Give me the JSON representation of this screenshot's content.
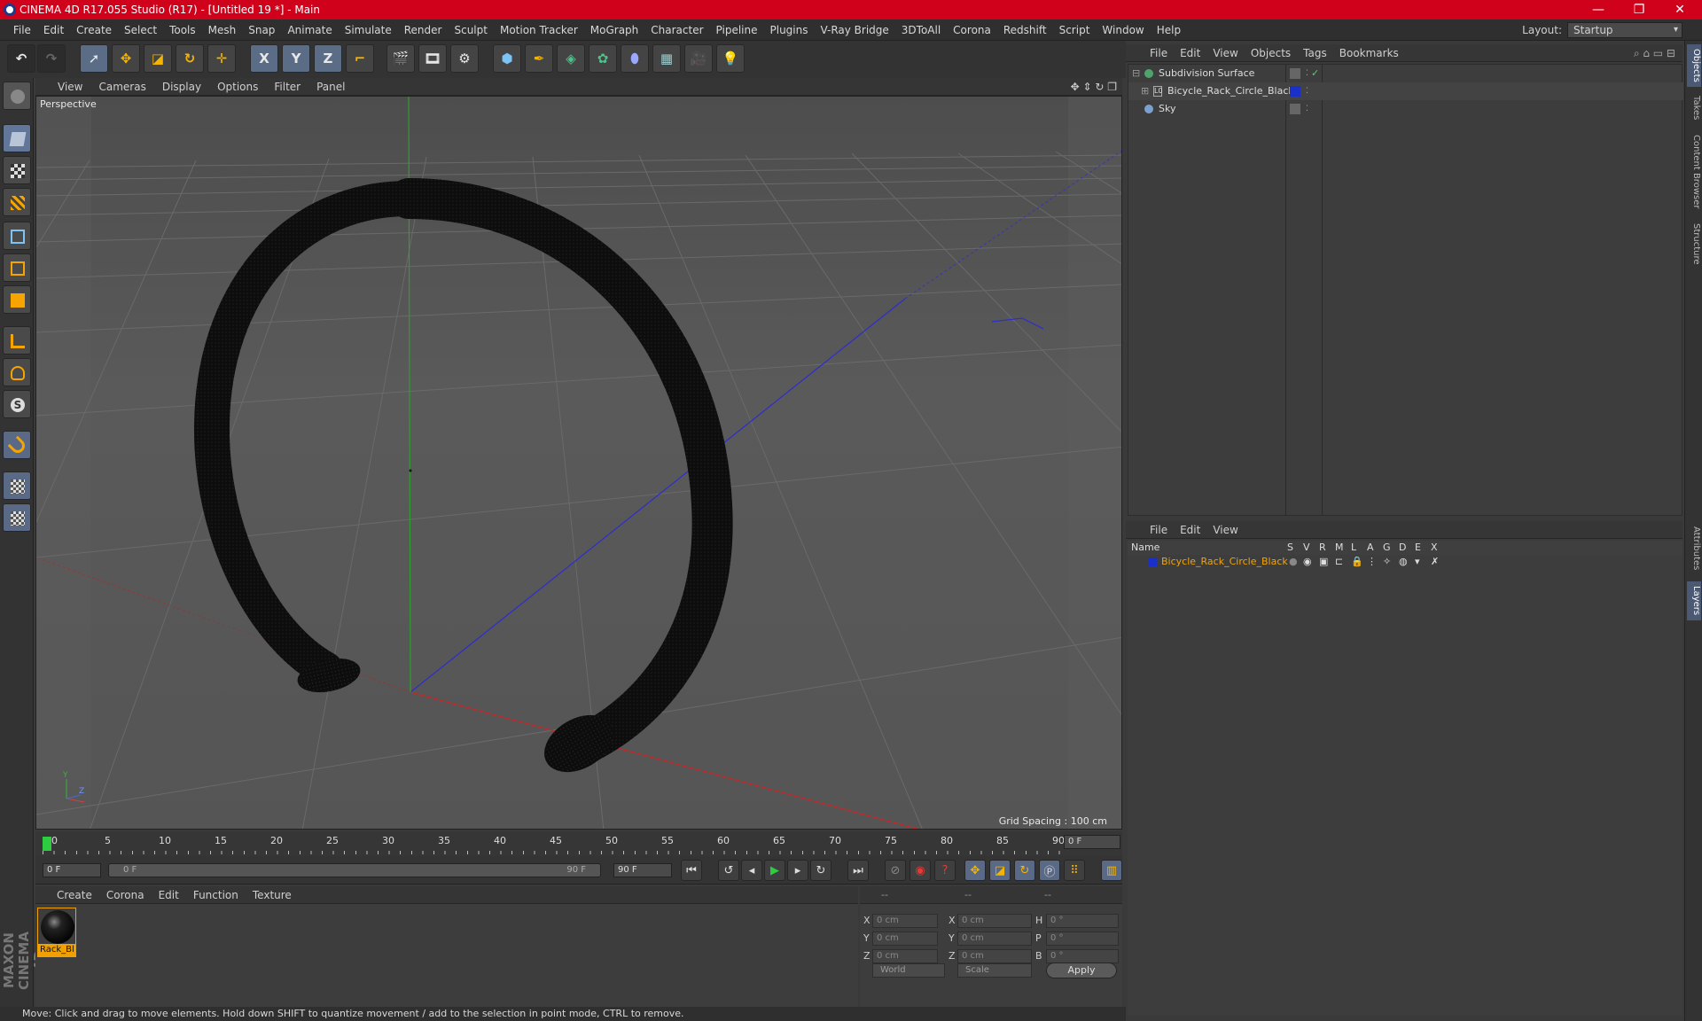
{
  "window": {
    "title": "CINEMA 4D R17.055 Studio (R17) - [Untitled 19 *] - Main",
    "minimize": "—",
    "maximize": "❐",
    "close": "✕"
  },
  "menubar": {
    "items": [
      "File",
      "Edit",
      "Create",
      "Select",
      "Tools",
      "Mesh",
      "Snap",
      "Animate",
      "Simulate",
      "Render",
      "Sculpt",
      "Motion Tracker",
      "MoGraph",
      "Character",
      "Pipeline",
      "Plugins",
      "V-Ray Bridge",
      "3DToAll",
      "Corona",
      "Redshift",
      "Script",
      "Window",
      "Help"
    ],
    "layout_label": "Layout:",
    "layout_value": "Startup"
  },
  "toolbar": {
    "axis_x": "X",
    "axis_y": "Y",
    "axis_z": "Z"
  },
  "viewport": {
    "menu": [
      "View",
      "Cameras",
      "Display",
      "Options",
      "Filter",
      "Panel"
    ],
    "label": "Perspective",
    "grid_spacing": "Grid Spacing : 100 cm",
    "axis_y": "Y",
    "axis_z": "Z"
  },
  "timeline": {
    "ticks": [
      "0",
      "5",
      "10",
      "15",
      "20",
      "25",
      "30",
      "35",
      "40",
      "45",
      "50",
      "55",
      "60",
      "65",
      "70",
      "75",
      "80",
      "85",
      "90"
    ],
    "current_frame": "0 F",
    "start_field": "0 F",
    "range_start": "0 F",
    "range_end": "90 F",
    "end_field": "90 F"
  },
  "material_manager": {
    "menu": [
      "Create",
      "Corona",
      "Edit",
      "Function",
      "Texture"
    ],
    "material_name": "Rack_Bl"
  },
  "coordinates": {
    "header": [
      "--",
      "--",
      "--"
    ],
    "pos_labels": [
      "X",
      "Y",
      "Z"
    ],
    "pos_values": [
      "0 cm",
      "0 cm",
      "0 cm"
    ],
    "size_labels": [
      "X",
      "Y",
      "Z"
    ],
    "size_values": [
      "0 cm",
      "0 cm",
      "0 cm"
    ],
    "rot_labels": [
      "H",
      "P",
      "B"
    ],
    "rot_values": [
      "0 °",
      "0 °",
      "0 °"
    ],
    "mode_world": "World",
    "mode_scale": "Scale",
    "apply": "Apply"
  },
  "object_manager": {
    "menu": [
      "File",
      "Edit",
      "View",
      "Objects",
      "Tags",
      "Bookmarks"
    ],
    "objects": [
      {
        "name": "Subdivision Surface",
        "color": "#4ea36a"
      },
      {
        "name": "Bicycle_Rack_Circle_Black",
        "color": "#1b2fc9"
      },
      {
        "name": "Sky",
        "color": "#7b9fcf"
      }
    ]
  },
  "layer_manager": {
    "menu": [
      "File",
      "Edit",
      "View"
    ],
    "columns": [
      "Name",
      "S",
      "V",
      "R",
      "M",
      "L",
      "A",
      "G",
      "D",
      "E",
      "X"
    ],
    "layers": [
      {
        "name": "Bicycle_Rack_Circle_Black",
        "color": "#1b2fc9"
      }
    ]
  },
  "side_tabs": [
    "Objects",
    "Takes",
    "Content Browser",
    "Structure",
    "Attributes",
    "Layers"
  ],
  "maxon_logo": "MAXON CINEMA 4D",
  "status": "Move: Click and drag to move elements. Hold down SHIFT to quantize movement / add to the selection in point mode, CTRL to remove."
}
